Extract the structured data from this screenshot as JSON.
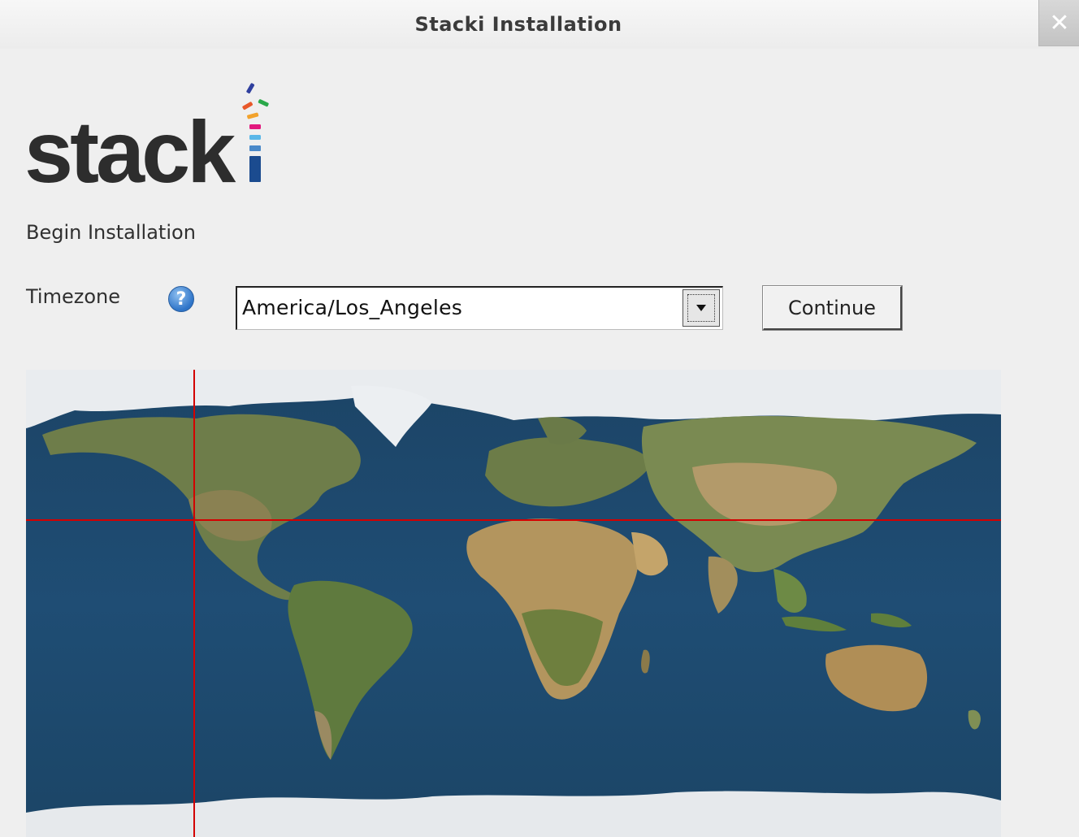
{
  "window": {
    "title": "Stacki Installation"
  },
  "logo": {
    "text": "stack"
  },
  "main": {
    "section_title": "Begin Installation",
    "timezone_label": "Timezone",
    "help_glyph": "?",
    "timezone_value": "America/Los_Angeles",
    "continue_label": "Continue"
  },
  "icons": {
    "close": "close-icon",
    "help": "help-icon",
    "dropdown": "chevron-down-icon"
  },
  "colors": {
    "crosshair": "#d40000",
    "ocean": "#1e4a6e",
    "logo_text": "#2d2d2d"
  }
}
